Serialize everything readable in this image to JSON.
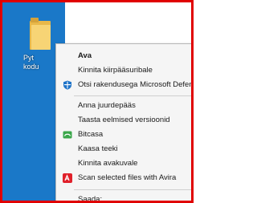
{
  "desktop": {
    "folder_caption_line1": "Pyt",
    "folder_caption_line2": "kodu"
  },
  "context_menu": {
    "items": [
      {
        "label": "Ava",
        "bold": true
      },
      {
        "label": "Kinnita kiirpääsuribale"
      },
      {
        "label": "Otsi rakendusega Microsoft Defender...",
        "icon": "defender-shield-icon"
      },
      {
        "label": "Anna juurdepääs"
      },
      {
        "label": "Taasta eelmised versioonid"
      },
      {
        "label": "Bitcasa",
        "icon": "bitcasa-icon"
      },
      {
        "label": "Kaasa teeki"
      },
      {
        "label": "Kinnita avakuvale"
      },
      {
        "label": "Scan selected files with Avira",
        "icon": "avira-icon"
      },
      {
        "label": "Saada:"
      }
    ]
  },
  "colors": {
    "frame_border": "#e00000",
    "desktop_bg": "#1a78c8",
    "menu_bg": "#f5f5f5",
    "avira_red": "#e0202a",
    "defender_blue": "#1e73c8",
    "bitcasa_green": "#3aa64a"
  }
}
